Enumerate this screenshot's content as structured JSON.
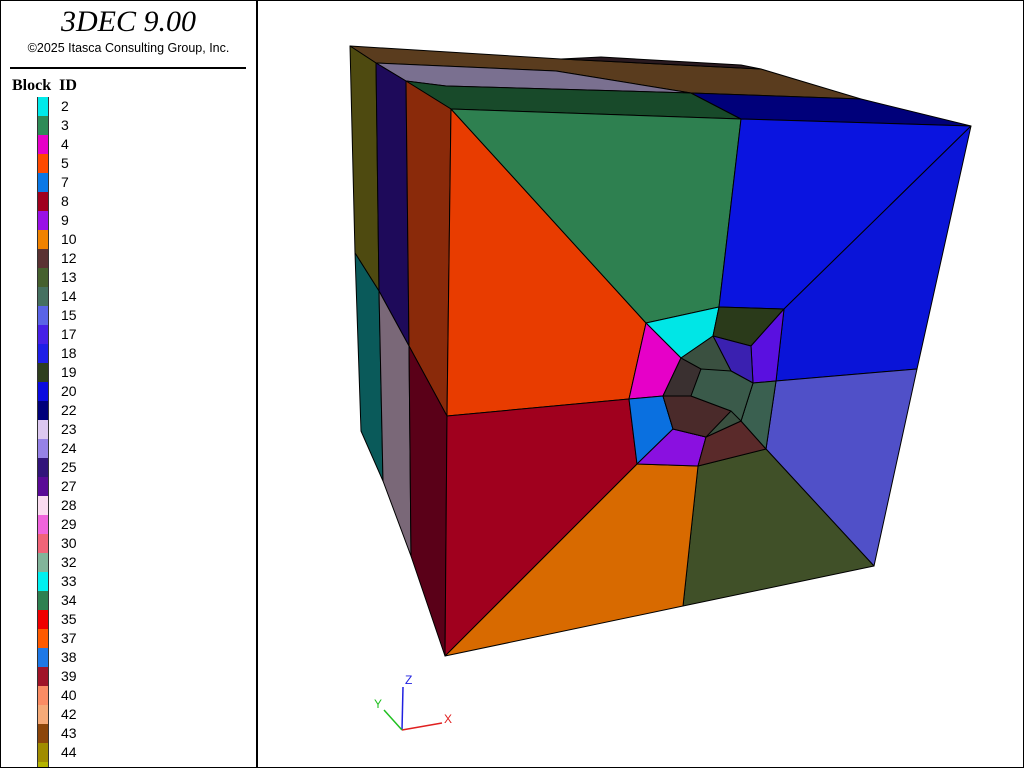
{
  "header": {
    "app_title": "3DEC 9.00",
    "copyright": "©2025 Itasca Consulting Group, Inc."
  },
  "legend": {
    "title": "Block  ID",
    "items": [
      {
        "label": "2",
        "color": "#00eaea"
      },
      {
        "label": "3",
        "color": "#2e8b57"
      },
      {
        "label": "4",
        "color": "#e600c8"
      },
      {
        "label": "5",
        "color": "#ff4a00"
      },
      {
        "label": "7",
        "color": "#0a78e6"
      },
      {
        "label": "8",
        "color": "#a0001e"
      },
      {
        "label": "9",
        "color": "#9a10e6"
      },
      {
        "label": "10",
        "color": "#f08200"
      },
      {
        "label": "12",
        "color": "#5a3232"
      },
      {
        "label": "13",
        "color": "#46602e"
      },
      {
        "label": "14",
        "color": "#467060"
      },
      {
        "label": "15",
        "color": "#5a64e6"
      },
      {
        "label": "17",
        "color": "#4620e6"
      },
      {
        "label": "18",
        "color": "#1e1ee6"
      },
      {
        "label": "19",
        "color": "#2e3e1e"
      },
      {
        "label": "20",
        "color": "#0a0ae0"
      },
      {
        "label": "22",
        "color": "#00007a"
      },
      {
        "label": "23",
        "color": "#dcc8f0"
      },
      {
        "label": "24",
        "color": "#9682e6"
      },
      {
        "label": "25",
        "color": "#32147a"
      },
      {
        "label": "27",
        "color": "#5a0a96"
      },
      {
        "label": "28",
        "color": "#fadcf0"
      },
      {
        "label": "29",
        "color": "#f064dc"
      },
      {
        "label": "30",
        "color": "#f06478"
      },
      {
        "label": "32",
        "color": "#82b49a"
      },
      {
        "label": "33",
        "color": "#00f0f0"
      },
      {
        "label": "34",
        "color": "#2e8050"
      },
      {
        "label": "35",
        "color": "#f00000"
      },
      {
        "label": "37",
        "color": "#ff5a00"
      },
      {
        "label": "38",
        "color": "#1e78e6"
      },
      {
        "label": "39",
        "color": "#a01428"
      },
      {
        "label": "40",
        "color": "#fa8c64"
      },
      {
        "label": "42",
        "color": "#f5aa78"
      },
      {
        "label": "43",
        "color": "#8c460a"
      },
      {
        "label": "44",
        "color": "#a08c00"
      },
      {
        "label": "",
        "color": "#b4b400"
      }
    ]
  },
  "axes": {
    "x_label": "X",
    "y_label": "Y",
    "z_label": "Z",
    "x_color": "#e02020",
    "y_color": "#20c020",
    "z_color": "#2020e0"
  }
}
